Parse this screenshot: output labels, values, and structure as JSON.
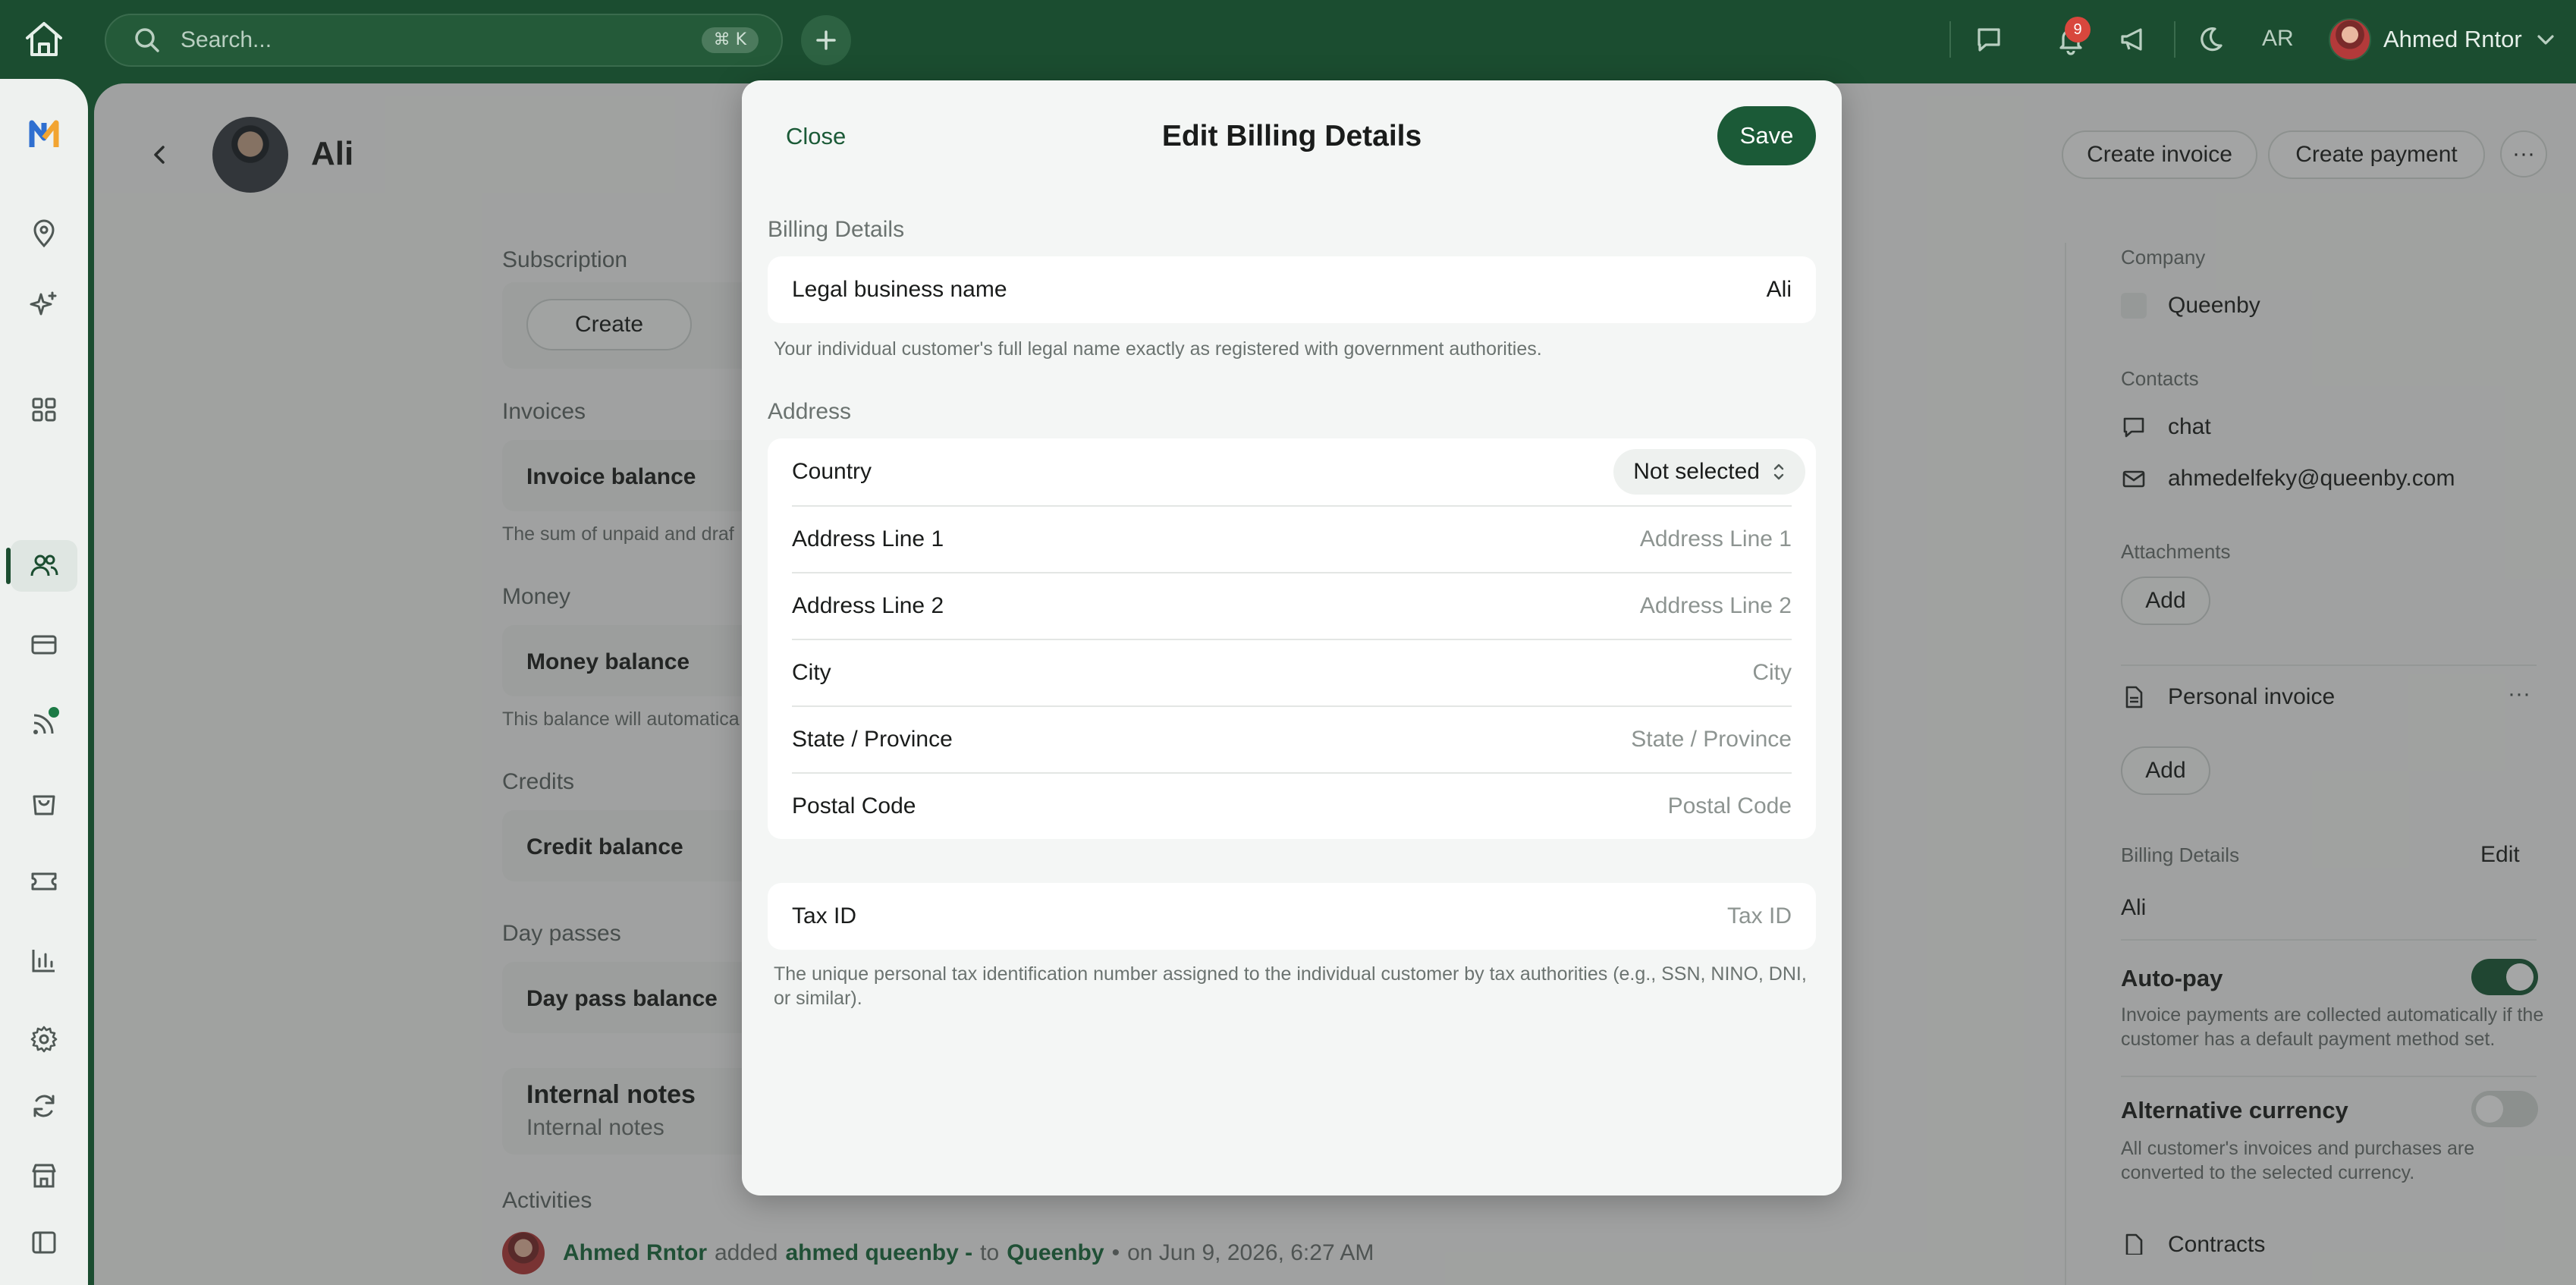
{
  "topbar": {
    "search_placeholder": "Search...",
    "search_shortcut": "⌘ K",
    "notification_count": "9",
    "initials": "AR",
    "user_name": "Ahmed Rntor"
  },
  "header": {
    "customer_name": "Ali",
    "create_invoice": "Create invoice",
    "create_payment": "Create payment",
    "more": "···"
  },
  "main": {
    "subscription_label": "Subscription",
    "subscription_create": "Create",
    "invoices_label": "Invoices",
    "invoice_balance": "Invoice balance",
    "invoice_note": "The sum of unpaid and draf",
    "money_label": "Money",
    "money_balance": "Money balance",
    "money_note": "This balance will automatica",
    "credits_label": "Credits",
    "credit_balance": "Credit balance",
    "daypasses_label": "Day passes",
    "daypass_balance": "Day pass balance",
    "notes_title": "Internal notes",
    "notes_placeholder": "Internal notes",
    "activities_label": "Activities",
    "activity": {
      "actor": "Ahmed Rntor",
      "verb": "added",
      "object": "ahmed queenby -",
      "prep": "to",
      "target": "Queenby",
      "bullet": "•",
      "time": "on Jun 9, 2026, 6:27 AM"
    }
  },
  "right_panel": {
    "company_label": "Company",
    "company_name": "Queenby",
    "contacts_label": "Contacts",
    "contact_chat": "chat",
    "contact_email": "ahmedelfeky@queenby.com",
    "attachments_label": "Attachments",
    "add": "Add",
    "personal_invoice": "Personal invoice",
    "personal_invoice_more": "···",
    "billing_details_label": "Billing Details",
    "edit": "Edit",
    "billing_name": "Ali",
    "autopay_title": "Auto-pay",
    "autopay_desc": "Invoice payments are collected automatically if the customer has a default payment method set.",
    "autopay_on": true,
    "altcurrency_title": "Alternative currency",
    "altcurrency_desc": "All customer's invoices and purchases are converted to the selected currency.",
    "altcurrency_on": false,
    "truncated_next": "Contracts"
  },
  "modal": {
    "close": "Close",
    "title": "Edit Billing Details",
    "save": "Save",
    "billing_section": "Billing Details",
    "legal_name_label": "Legal business name",
    "legal_name_value": "Ali",
    "legal_name_note": "Your individual customer's full legal name exactly as registered with government authorities.",
    "address_section": "Address",
    "country_label": "Country",
    "country_value": "Not selected",
    "address1_label": "Address Line 1",
    "address1_placeholder": "Address Line 1",
    "address2_label": "Address Line 2",
    "address2_placeholder": "Address Line 2",
    "city_label": "City",
    "city_placeholder": "City",
    "state_label": "State / Province",
    "state_placeholder": "State / Province",
    "postal_label": "Postal Code",
    "postal_placeholder": "Postal Code",
    "taxid_label": "Tax ID",
    "taxid_placeholder": "Tax ID",
    "taxid_note": "The unique personal tax identification number assigned to the individual customer by tax authorities (e.g., SSN, NINO, DNI, or similar)."
  },
  "colors": {
    "brand_green": "#1b4d30",
    "accent_green": "#1b5a37",
    "badge_red": "#d8473d"
  }
}
